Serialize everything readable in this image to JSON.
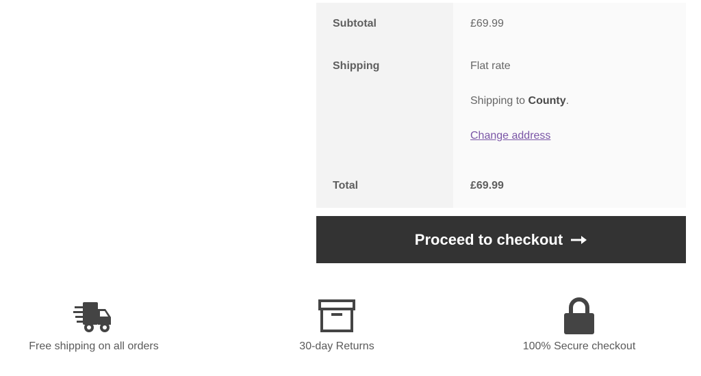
{
  "totals": {
    "subtotal_label": "Subtotal",
    "subtotal_value": "£69.99",
    "shipping_label": "Shipping",
    "shipping_method": "Flat rate",
    "shipping_to_prefix": "Shipping to ",
    "shipping_to_place": "County",
    "shipping_to_suffix": ".",
    "change_address_link": "Change address",
    "total_label": "Total",
    "total_value": "£69.99"
  },
  "checkout": {
    "button_label": "Proceed to checkout",
    "icon": "arrow-right-icon"
  },
  "features": [
    {
      "icon": "fast-truck-icon",
      "caption": "Free shipping on all orders"
    },
    {
      "icon": "archive-box-icon",
      "caption": "30-day Returns"
    },
    {
      "icon": "padlock-icon",
      "caption": "100% Secure checkout"
    }
  ],
  "colors": {
    "button_bg": "#333333",
    "link": "#7a55a6",
    "label_cell_bg": "#f3f3f3",
    "value_cell_bg": "#fafafa"
  }
}
